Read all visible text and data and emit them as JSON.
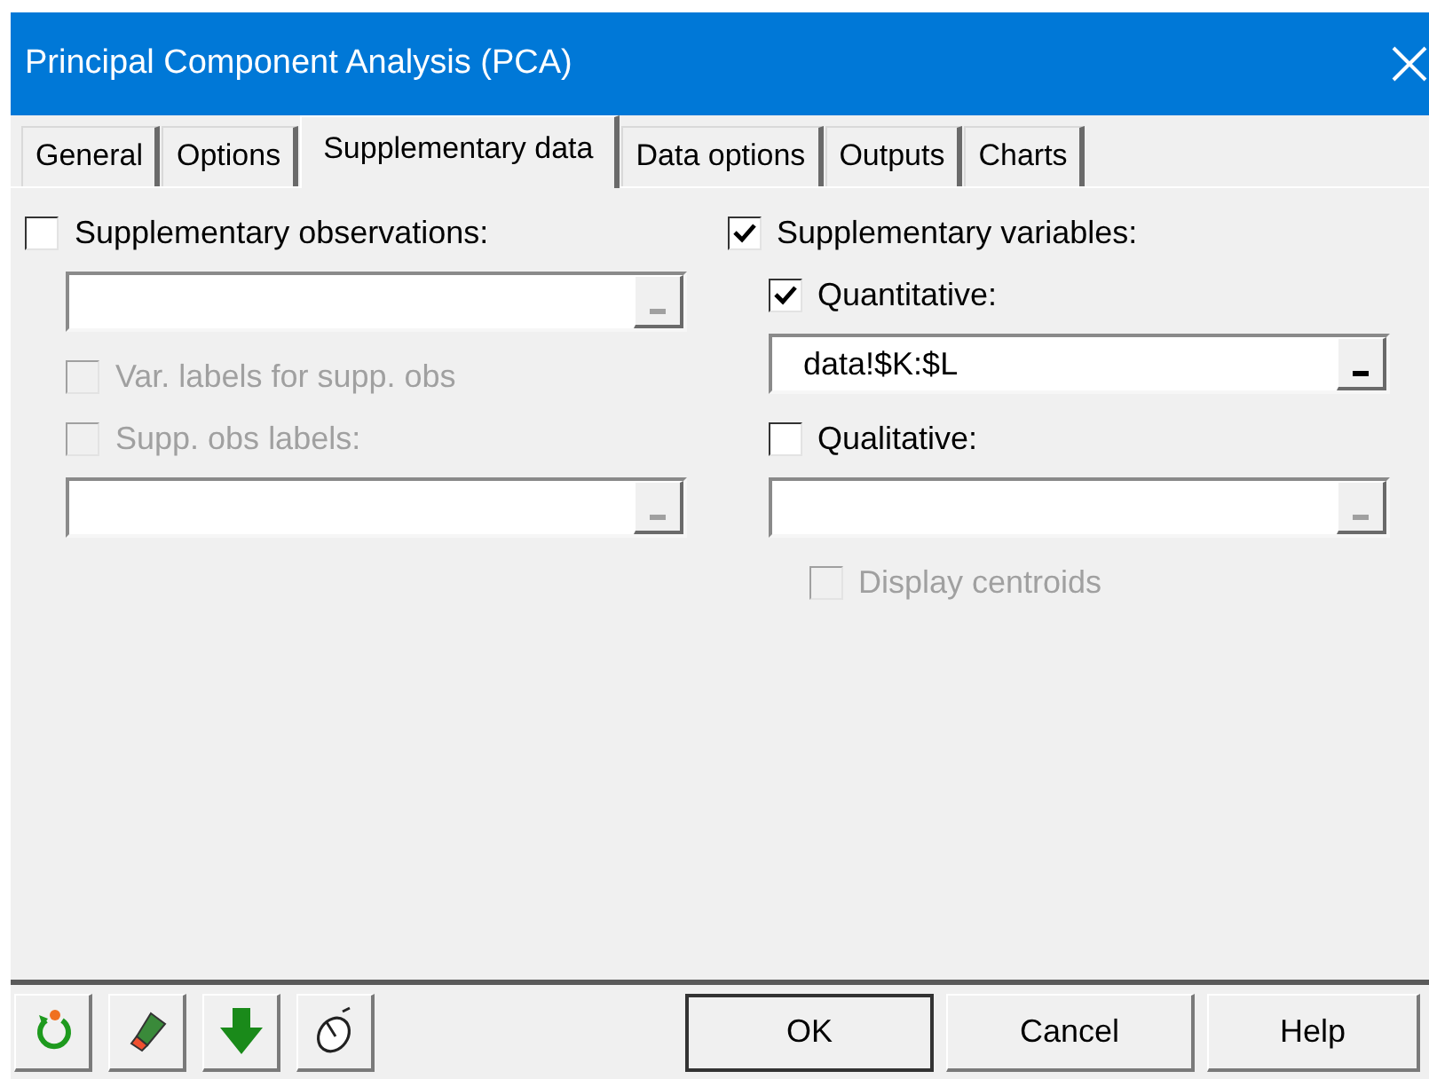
{
  "window": {
    "title": "Principal Component Analysis (PCA)"
  },
  "tabs": [
    {
      "label": "General",
      "selected": false
    },
    {
      "label": "Options",
      "selected": false
    },
    {
      "label": "Supplementary data",
      "selected": true
    },
    {
      "label": "Data options",
      "selected": false
    },
    {
      "label": "Outputs",
      "selected": false
    },
    {
      "label": "Charts",
      "selected": false
    }
  ],
  "left_column": [
    {
      "kind": "checkbox",
      "label": "Supplementary observations:",
      "checked": false,
      "disabled": false,
      "children": [
        {
          "kind": "field",
          "disabled": true
        },
        {
          "kind": "checkbox",
          "label": "Var. labels for supp. obs",
          "checked": false,
          "disabled": true
        },
        {
          "kind": "checkbox",
          "label": "Supp. obs labels:",
          "checked": false,
          "disabled": true
        },
        {
          "kind": "field",
          "disabled": true
        }
      ]
    }
  ],
  "right_column": [
    {
      "kind": "checkbox",
      "label": "Supplementary variables:",
      "checked": true,
      "disabled": false,
      "children": [
        {
          "kind": "checkbox",
          "label": "Quantitative:",
          "checked": true,
          "disabled": false
        },
        {
          "kind": "field",
          "value": "data!$K:$L",
          "disabled": false
        },
        {
          "kind": "checkbox",
          "label": "Qualitative:",
          "checked": false,
          "disabled": false
        },
        {
          "kind": "field",
          "disabled": true,
          "children": [
            {
              "kind": "checkbox",
              "label": "Display centroids",
              "checked": false,
              "disabled": true
            }
          ]
        }
      ]
    }
  ],
  "toolbar": [
    {
      "kind": "reset"
    },
    {
      "kind": "eraser"
    },
    {
      "kind": "down"
    },
    {
      "kind": "mouse"
    }
  ],
  "buttons": [
    {
      "label": "OK",
      "default": true
    },
    {
      "label": "Cancel",
      "default": false
    },
    {
      "label": "Help",
      "default": false
    }
  ]
}
